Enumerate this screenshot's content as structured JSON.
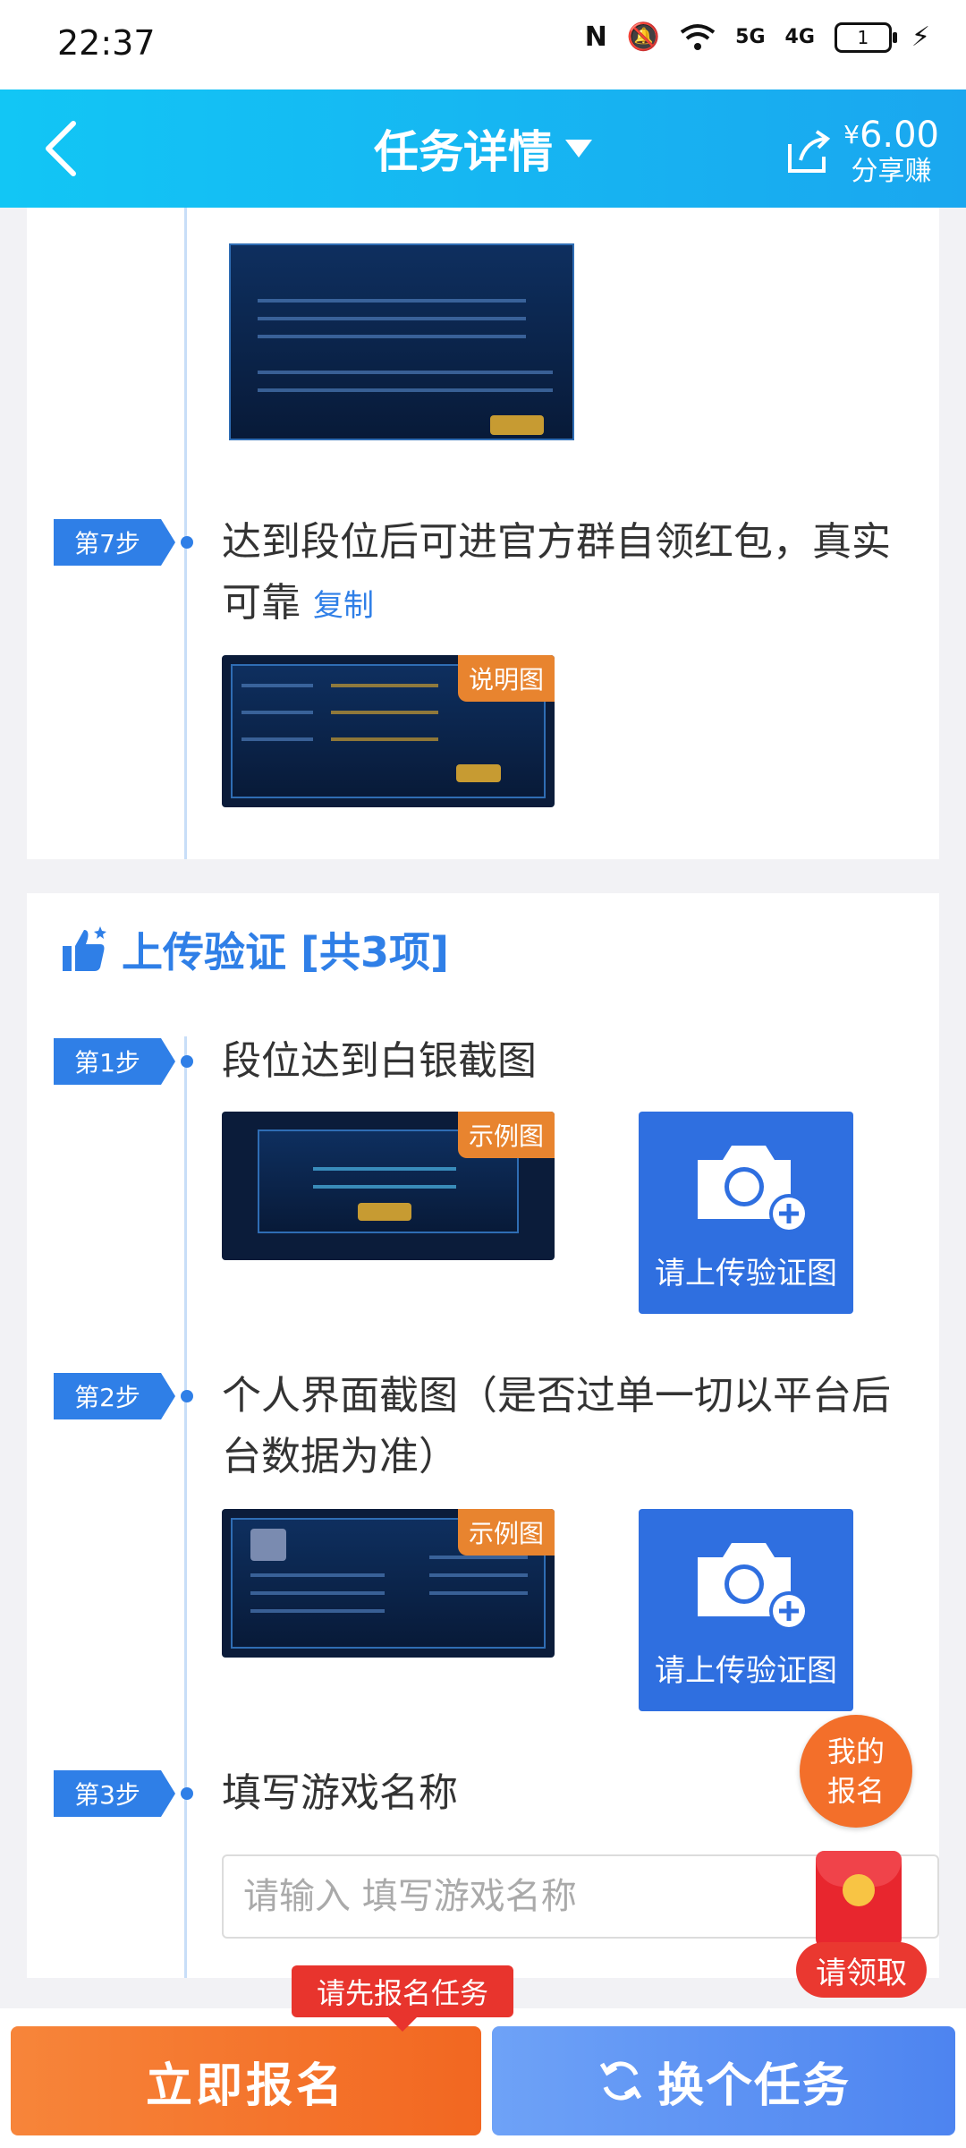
{
  "status_bar": {
    "time": "22:37",
    "battery": "1",
    "net1": "5G",
    "net2": "4G"
  },
  "header": {
    "title": "任务详情",
    "share_price": "6.00",
    "currency": "¥",
    "share_label": "分享赚"
  },
  "steps_card": {
    "step7": {
      "tag": "第7步",
      "text": "达到段位后可进官方群自领红包，真实可靠",
      "copy": "复制",
      "image_badge": "说明图"
    }
  },
  "upload_section": {
    "title": "上传验证 [共3项]",
    "steps": [
      {
        "tag": "第1步",
        "text": "段位达到白银截图",
        "image_badge": "示例图",
        "upload_label": "请上传验证图"
      },
      {
        "tag": "第2步",
        "text": "个人界面截图（是否过单一切以平台后台数据为准）",
        "image_badge": "示例图",
        "upload_label": "请上传验证图"
      },
      {
        "tag": "第3步",
        "text": "填写游戏名称",
        "input_placeholder": "请输入 填写游戏名称",
        "input_value": ""
      }
    ]
  },
  "floating": {
    "my_signup": [
      "我的",
      "报名"
    ],
    "claim": "请领取"
  },
  "bottom_bar": {
    "tooltip": "请先报名任务",
    "signup": "立即报名",
    "switch": "换个任务"
  },
  "colors": {
    "accent": "#2f7fe7",
    "header": "#1aa7ef",
    "orange": "#f26721"
  }
}
